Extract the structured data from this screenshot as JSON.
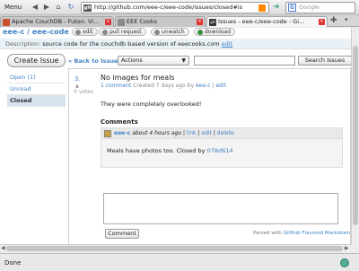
{
  "browser": {
    "menu_label": "Menu",
    "url": "http://github.com/eee-c/eee-code/issues/closed#is",
    "search_placeholder": "Google",
    "tabs": [
      {
        "label": "Apache CouchDB - Futon: Vi...",
        "icon_color": "#c94f2f"
      },
      {
        "label": "EEE Cooks",
        "icon_color": "#8a8a8a"
      },
      {
        "label": "Issues - eee-c/eee-code - Gi...",
        "icon_color": "#333333"
      }
    ],
    "status_text": "Done"
  },
  "repo": {
    "title": "eee-c / eee-code",
    "actions": [
      "edit",
      "pull request",
      "unwatch",
      "download"
    ],
    "description_label": "Description:",
    "description": "source code for the couchdb based version of eeecooks.com",
    "description_edit": "edit"
  },
  "issues": {
    "create_label": "Create Issue",
    "back_label": "« Back to Issues",
    "actions_select": "Actions",
    "search_button": "Search Issues",
    "sidebar": [
      {
        "label": "Open (1)",
        "selected": false
      },
      {
        "label": "Unread",
        "selected": false
      },
      {
        "label": "Closed",
        "selected": true
      }
    ]
  },
  "issue": {
    "number": "3.",
    "votes": "0 votes",
    "title": "No images for meals",
    "comment_count": "1 comment",
    "created": "Created 7 days ago by",
    "author": "eee-c",
    "edit": "edit",
    "body": "They were completely overlooked!"
  },
  "comments": {
    "heading": "Comments",
    "items": [
      {
        "author": "eee-c",
        "time": "about 4 hours ago",
        "actions": [
          "link",
          "edit",
          "delete"
        ],
        "text_prefix": "Meals have photos too. Closed by",
        "commit": "078d614"
      }
    ],
    "comment_button": "Comment",
    "parsed_prefix": "Parsed with",
    "parsed_link": "GitHub Flavored Markdown"
  },
  "colors": {
    "link": "#4183c4",
    "selected_bg": "#d7e4ef",
    "desc_bg": "#e9f1f6"
  }
}
